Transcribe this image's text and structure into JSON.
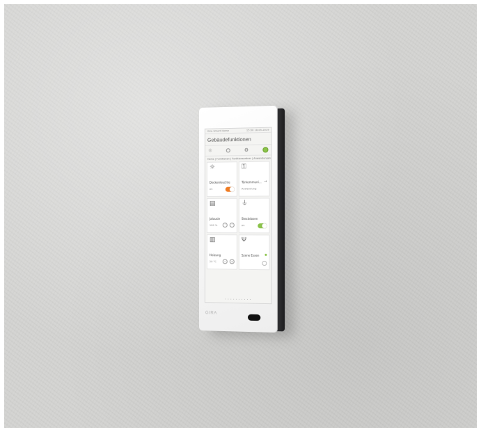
{
  "device": {
    "brand": "GIRA",
    "status_left": "Gira Smart Home",
    "status_right": "15:00  18.05.2019",
    "page_title": "Gebäudefunktionen",
    "breadcrumb": "Home | Funktionen | Funktionsordner | Anwendungen",
    "pager": "• • • • • • • • • •",
    "active_color": "#8bc34a",
    "toggle_orange": "#f07b22",
    "toggle_green": "#8bc34a",
    "icons": [
      "sun-icon",
      "lamp-icon",
      "gear-icon",
      "power-icon"
    ],
    "tiles": {
      "ceiling_light": {
        "label": "Deckenleuchte",
        "state": "an"
      },
      "door": {
        "label": "Türkommuni...",
        "sub": "Anwendung",
        "arrow": "→"
      },
      "blinds": {
        "label": "Jalousie",
        "value": "100 %"
      },
      "socket": {
        "label": "Steckdosen",
        "state": "an"
      },
      "heating": {
        "label": "Heizung",
        "value": "20 °C"
      },
      "scene": {
        "label": "Szene Essen"
      }
    }
  }
}
